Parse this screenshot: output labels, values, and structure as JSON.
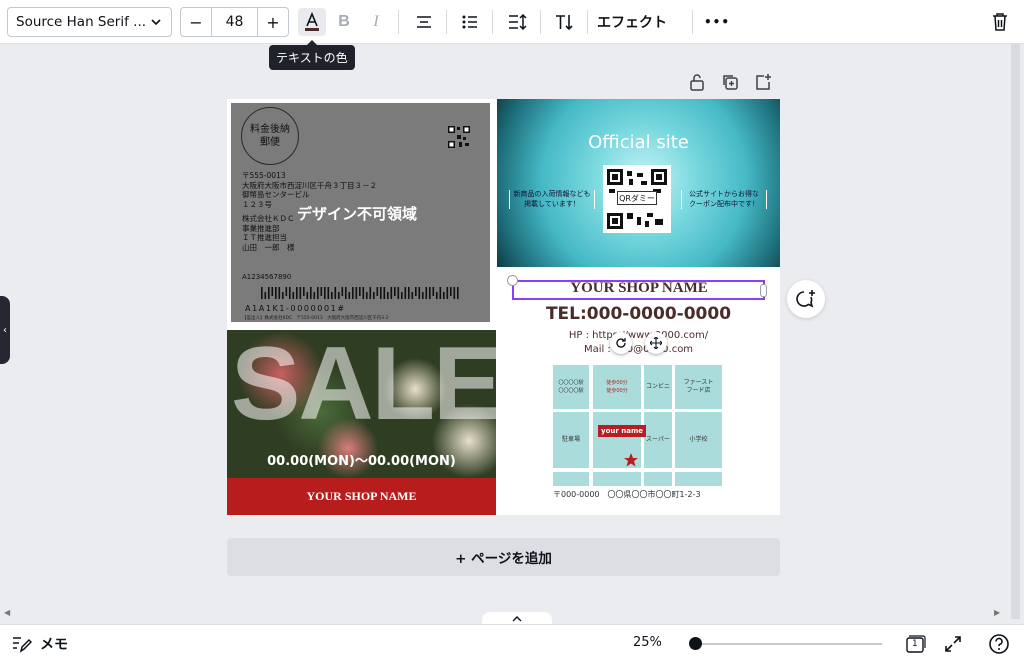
{
  "toolbar": {
    "font_name": "Source Han Serif ...",
    "size_decrease": "−",
    "font_size": "48",
    "size_increase": "+",
    "effects_label": "エフェクト",
    "more_label": "•••",
    "tooltip": "テキストの色",
    "text_color_hex": "#4a2c2a"
  },
  "design": {
    "stamp_text": "料金後納\n郵便",
    "address_lines": [
      "〒555-0013",
      "大阪府大阪市西淀川区千舟３丁目３－２",
      "御幣島センタービル",
      "１２３号",
      "",
      "株式会社ＫＤＣ",
      "事業推進部",
      "ＩＴ推進担当",
      "山田　一郎　様"
    ],
    "no_design_area": "デザイン不可領域",
    "barcode_number": "A1234567890",
    "barcode_text": "A1A1K1-0000001#",
    "micro_text": "【差出人】株式会社KDC　〒555-0013　大阪府大阪市西淀川区千舟3-2",
    "official_title": "Official site",
    "left_note": "新商品の入荷情報なども\n掲載しています！",
    "right_note": "公式サイトからお得な\nクーポン配布中です！",
    "qr_label": "QRダミー",
    "shop_name": "YOUR SHOP NAME",
    "tel": "TEL:000-0000-0000",
    "hp": "HP : https://www.0000.com/",
    "mail": "Mail : 000@0000.com",
    "map": {
      "station": "〇〇〇〇駅\n〇〇〇〇駅",
      "walk": "徒歩00分\n徒歩00分",
      "convenience": "コンビニ",
      "fastfood": "ファースト\nフード店",
      "parking": "駐車場",
      "super": "スーパー",
      "school": "小学校",
      "pin_label": "your name"
    },
    "address_line": "〒000-0000　〇〇県〇〇市〇〇町1-2-3",
    "sale_word": "SALE",
    "sale_dates": "00.00(MON)〜00.00(MON)",
    "sale_shop": "YOUR SHOP NAME"
  },
  "add_page": "+ ページを追加",
  "bottom": {
    "memo": "メモ",
    "zoom": "25%",
    "zoom_level": 0.25,
    "page_count": "1"
  }
}
